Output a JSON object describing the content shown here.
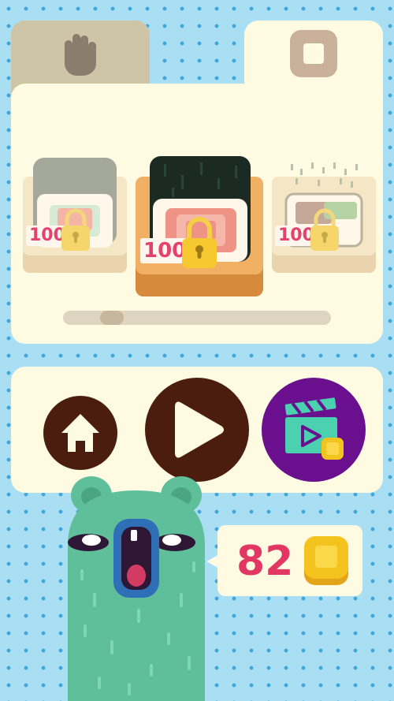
{
  "tabs": [
    {
      "icon": "hand-icon",
      "state": "inactive"
    },
    {
      "icon": "square-icon",
      "state": "active"
    }
  ],
  "skins": [
    {
      "price": "100",
      "locked": true,
      "selected": false
    },
    {
      "price": "100",
      "locked": true,
      "selected": true
    },
    {
      "price": "100",
      "locked": true,
      "selected": false
    }
  ],
  "carousel": {
    "scroll_position": 0.07
  },
  "actions": [
    {
      "icon": "home-icon"
    },
    {
      "icon": "play-icon"
    },
    {
      "icon": "video-reward-icon"
    }
  ],
  "wallet": {
    "coins": "82",
    "icon": "coin-icon"
  },
  "colors": {
    "accent": "#e23763",
    "dark": "#4b1d0e",
    "purple": "#6a0f8e",
    "mint": "#4bd0b0",
    "character": "#5fbf9b"
  }
}
